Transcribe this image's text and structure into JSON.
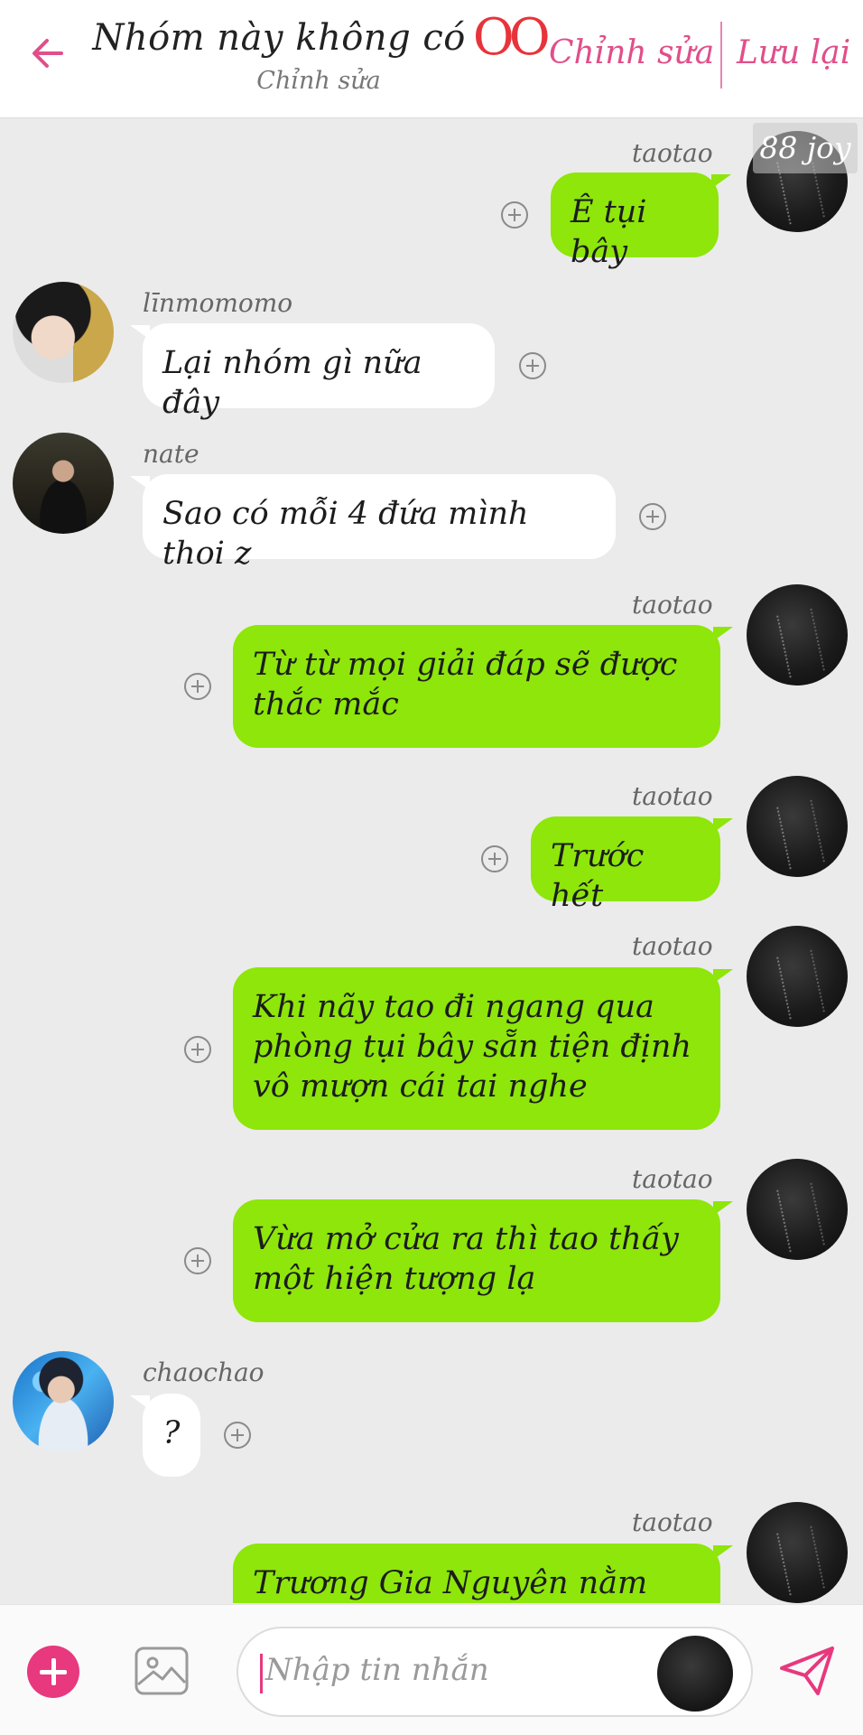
{
  "header": {
    "title": "Nhóm này không có",
    "title_mark": "OO",
    "subtitle": "Chỉnh sửa",
    "edit_label": "Chỉnh sửa",
    "save_label": "Lưu lại",
    "back_icon": "arrow-left-icon"
  },
  "watermark": "88 joy",
  "messages": [
    {
      "sender": "taotao",
      "direction": "out",
      "text": "Ê tụi bây"
    },
    {
      "sender": "līnmomomo",
      "direction": "in",
      "text": "Lại nhóm gì nữa đây"
    },
    {
      "sender": "nate",
      "direction": "in",
      "text": "Sao có mỗi 4 đứa mình thoi z"
    },
    {
      "sender": "taotao",
      "direction": "out",
      "text": "Từ từ mọi giải đáp sẽ được thắc mắc"
    },
    {
      "sender": "taotao",
      "direction": "out",
      "text": "Trước hết"
    },
    {
      "sender": "taotao",
      "direction": "out",
      "text": "Khi nãy tao đi ngang qua phòng tụi bây sẵn tiện định vô mượn cái tai nghe"
    },
    {
      "sender": "taotao",
      "direction": "out",
      "text": "Vừa mở cửa ra thì tao thấy một hiện tượng lạ"
    },
    {
      "sender": "chaochao",
      "direction": "in",
      "text": "?"
    },
    {
      "sender": "taotao",
      "direction": "out",
      "text": "Trương Gia Nguyên nằm"
    }
  ],
  "composer": {
    "placeholder": "Nhập tin nhắn",
    "add_icon": "plus-circle-icon",
    "image_icon": "image-icon",
    "send_icon": "send-icon"
  },
  "colors": {
    "accent": "#e8387e",
    "header_action": "#e04f8a",
    "outgoing_bubble": "#8ee60a",
    "incoming_bubble": "#ffffff",
    "chat_background": "#ebebeb"
  }
}
